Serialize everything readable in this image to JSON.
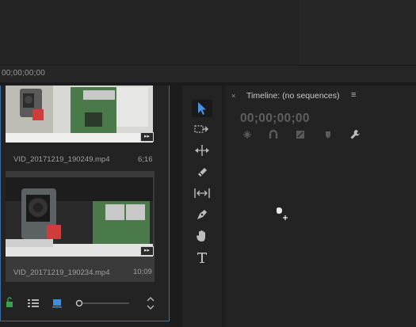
{
  "source_monitor": {
    "timecode": "00;00;00;00"
  },
  "project": {
    "clips": [
      {
        "name": "VID_20171219_190249.mp4",
        "duration": "6;16"
      },
      {
        "name": "VID_20171219_190234.mp4",
        "duration": "10;09"
      }
    ],
    "footer_icons": [
      "lock-icon",
      "list-view-icon",
      "icon-view-icon",
      "zoom-slider",
      "sort-icon"
    ]
  },
  "tools": [
    "selection-tool",
    "track-select-forward-tool",
    "ripple-edit-tool",
    "razor-tool",
    "slip-tool",
    "pen-tool",
    "hand-tool",
    "type-tool"
  ],
  "timeline": {
    "close": "×",
    "title": "Timeline: (no sequences)",
    "menu": "≡",
    "timecode": "00;00;00;00"
  },
  "colors": {
    "accent_blue": "#3a6ea8",
    "selection_tool": "#4a90e2"
  }
}
